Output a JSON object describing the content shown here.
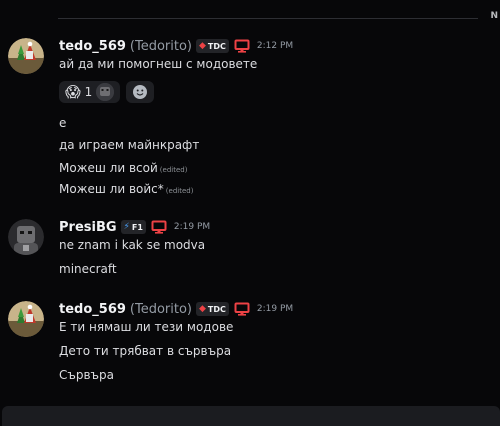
{
  "divider": {
    "label": "N"
  },
  "groups": [
    {
      "username": "tedo_569",
      "nickname": "(Tedorito)",
      "tag": {
        "label": "TDC",
        "icon": "red-gem-icon"
      },
      "timestamp": "2:12 PM",
      "messages": [
        {
          "text": "ай да ми помогнеш с модовете"
        },
        {
          "text": "е"
        },
        {
          "text": "да играем майнкрафт"
        },
        {
          "text": "Можеш ли всой",
          "edited": "(edited)"
        },
        {
          "text": "Можеш ли войс*",
          "edited": "(edited)"
        }
      ],
      "reactions": [
        {
          "emoji": "😱",
          "count": "1"
        }
      ]
    },
    {
      "username": "PresiBG",
      "tag": {
        "label": "F1",
        "icon": "lightning-icon"
      },
      "timestamp": "2:19 PM",
      "messages": [
        {
          "text": "ne znam i kak se modva"
        },
        {
          "text": "minecraft"
        }
      ]
    },
    {
      "username": "tedo_569",
      "nickname": "(Tedorito)",
      "tag": {
        "label": "TDC",
        "icon": "red-gem-icon"
      },
      "timestamp": "2:19 PM",
      "messages": [
        {
          "text": "Е ти нямаш ли тези модове"
        },
        {
          "text": "Дето ти трябват в сървъра"
        },
        {
          "text": "Сървъра"
        }
      ]
    }
  ],
  "colors": {
    "background": "#070709",
    "username": "#f2f3f5",
    "muted": "#949ba4",
    "monitor_icon": "#ed4245"
  }
}
